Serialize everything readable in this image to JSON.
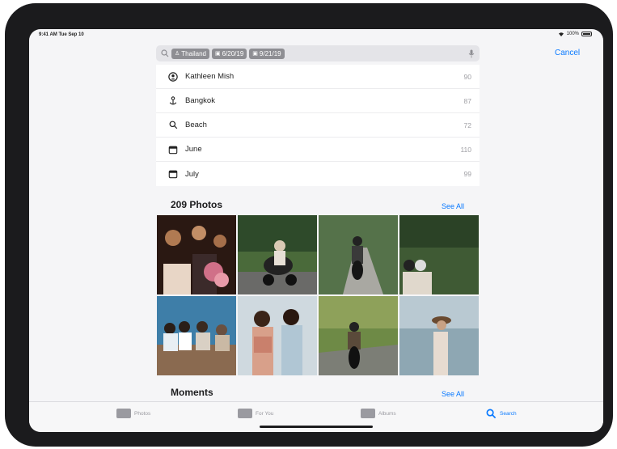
{
  "status": {
    "time": "9:41 AM  Tue Sep 10",
    "battery": "100%"
  },
  "search": {
    "tokens": [
      {
        "icon": "person-pin-icon",
        "label": "Thailand"
      },
      {
        "icon": "calendar-icon",
        "label": "6/20/19"
      },
      {
        "icon": "calendar-icon",
        "label": "9/21/19"
      }
    ],
    "cancel": "Cancel"
  },
  "suggestions": [
    {
      "icon": "person-circle-icon",
      "label": "Kathleen Mish",
      "count": "90"
    },
    {
      "icon": "location-pin-icon",
      "label": "Bangkok",
      "count": "87"
    },
    {
      "icon": "search-icon",
      "label": "Beach",
      "count": "72"
    },
    {
      "icon": "calendar-icon",
      "label": "June",
      "count": "110"
    },
    {
      "icon": "calendar-icon",
      "label": "July",
      "count": "99"
    }
  ],
  "photos_section": {
    "title": "209 Photos",
    "see_all": "See All"
  },
  "moments_section": {
    "title": "Moments",
    "see_all": "See All"
  },
  "photos": [
    "friends-with-flowers-night",
    "scooter-riders-forest",
    "scooter-on-road",
    "couple-on-scooter",
    "friends-on-pier",
    "women-laughing",
    "motorbike-rider-hills",
    "woman-in-hat-lakeside"
  ],
  "tabs": [
    {
      "label": "Photos",
      "icon": "photos-icon"
    },
    {
      "label": "For You",
      "icon": "for-you-icon"
    },
    {
      "label": "Albums",
      "icon": "albums-icon"
    },
    {
      "label": "Search",
      "icon": "search-icon"
    }
  ],
  "colors": {
    "accent": "#0a7aff",
    "token": "#8e8e93",
    "bezel": "#1b1b1d"
  }
}
